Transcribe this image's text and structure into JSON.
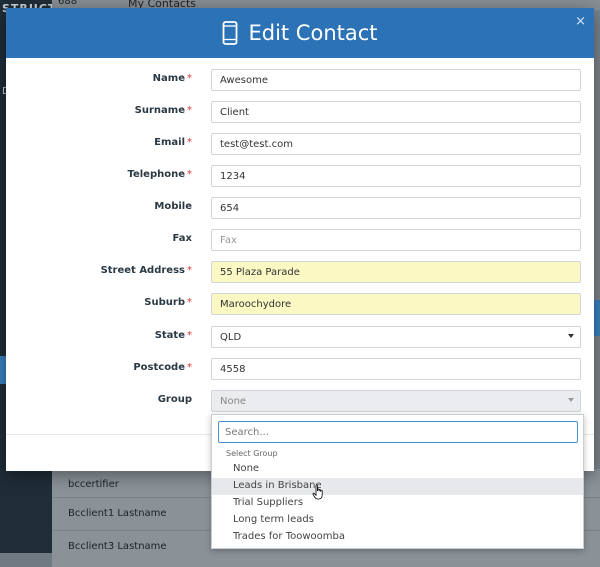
{
  "background": {
    "brand": "STRUCT",
    "sidebar_letter": "D",
    "top_number": "688",
    "top_tab": "My Contacts",
    "rows": [
      "bccertifier",
      "Bcclient1 Lastname",
      "Bcclient3 Lastname"
    ]
  },
  "modal": {
    "title": "Edit Contact",
    "close": "×",
    "fields": {
      "name": {
        "label": "Name",
        "value": "Awesome"
      },
      "surname": {
        "label": "Surname",
        "value": "Client"
      },
      "email": {
        "label": "Email",
        "value": "test@test.com"
      },
      "telephone": {
        "label": "Telephone",
        "value": "1234"
      },
      "mobile": {
        "label": "Mobile",
        "value": "654"
      },
      "fax": {
        "label": "Fax",
        "value": "",
        "placeholder": "Fax"
      },
      "street": {
        "label": "Street Address",
        "value": "55 Plaza Parade"
      },
      "suburb": {
        "label": "Suburb",
        "value": "Maroochydore"
      },
      "state": {
        "label": "State",
        "value": "QLD"
      },
      "postcode": {
        "label": "Postcode",
        "value": "4558"
      },
      "group": {
        "label": "Group",
        "value": "None"
      }
    },
    "required_mark": "*",
    "dropdown": {
      "search_placeholder": "Search...",
      "group_label": "Select Group",
      "options": [
        "None",
        "Leads in Brisbane",
        "Trial Suppliers",
        "Long term leads",
        "Trades for Toowoomba"
      ],
      "highlighted": "Leads in Brisbane"
    }
  },
  "colors": {
    "header": "#2b72b6",
    "autofill": "#fbf8c4",
    "required": "#d33333"
  }
}
